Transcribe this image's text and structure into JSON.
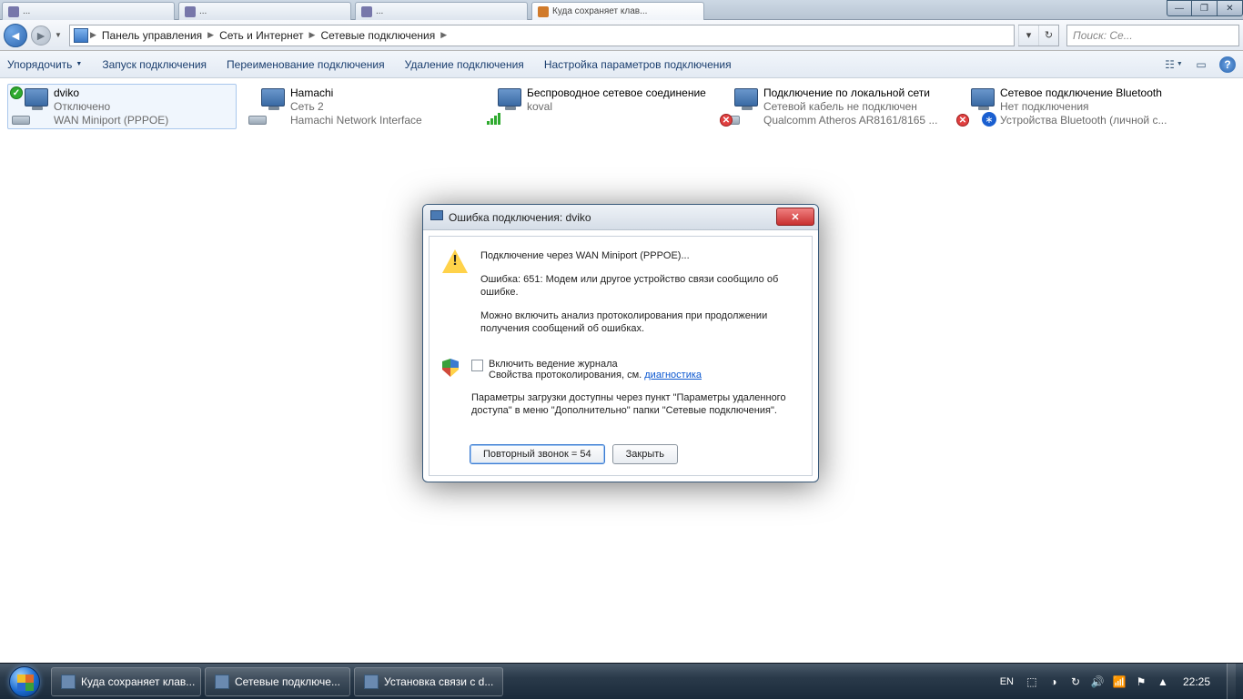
{
  "browser": {
    "tabs": [
      "...",
      "...",
      "...",
      "Куда сохраняет клав..."
    ]
  },
  "window_buttons": {
    "min": "—",
    "max": "❐",
    "close": "✕"
  },
  "nav": {
    "back": "◄",
    "fwd": "►",
    "crumbs": [
      "Панель управления",
      "Сеть и Интернет",
      "Сетевые подключения"
    ],
    "refresh": "↻",
    "search_placeholder": "Поиск: Се..."
  },
  "toolbar": {
    "organize": "Упорядочить",
    "start": "Запуск подключения",
    "rename": "Переименование подключения",
    "delete": "Удаление подключения",
    "settings": "Настройка параметров подключения",
    "help": "?"
  },
  "connections": [
    {
      "name": "dviko",
      "status": "Отключено",
      "device": "WAN Miniport (PPPOE)",
      "mark": "ok",
      "selected": true
    },
    {
      "name": "Hamachi",
      "status": "Сеть 2",
      "device": "Hamachi Network Interface"
    },
    {
      "name": "Беспроводное сетевое соединение",
      "status": "koval",
      "device": "",
      "wifi": true
    },
    {
      "name": "Подключение по локальной сети",
      "status": "Сетевой кабель не подключен",
      "device": "Qualcomm Atheros AR8161/8165 ...",
      "mark": "x"
    },
    {
      "name": "Сетевое подключение Bluetooth",
      "status": "Нет подключения",
      "device": "Устройства Bluetooth (личной с...",
      "mark": "x",
      "bt": true
    }
  ],
  "dialog": {
    "title": "Ошибка подключения: dviko",
    "line1": "Подключение через WAN Miniport (PPPOE)...",
    "line2": "Ошибка: 651: Модем или другое устройство связи сообщило об ошибке.",
    "line3": "Можно включить анализ протоколирования при продолжении получения сообщений об ошибках.",
    "check_label": "Включить ведение журнала",
    "proto_prefix": "Свойства протоколирования, см. ",
    "proto_link": "диагностика",
    "line4": "Параметры загрузки доступны через пункт \"Параметры удаленного доступа\" в меню \"Дополнительно\" папки \"Сетевые подключения\".",
    "btn_redial": "Повторный звонок = 54",
    "btn_close": "Закрыть"
  },
  "taskbar": {
    "items": [
      "Куда сохраняет клав...",
      "Сетевые подключе...",
      "Установка связи с d..."
    ],
    "lang": "EN",
    "clock": "22:25"
  }
}
